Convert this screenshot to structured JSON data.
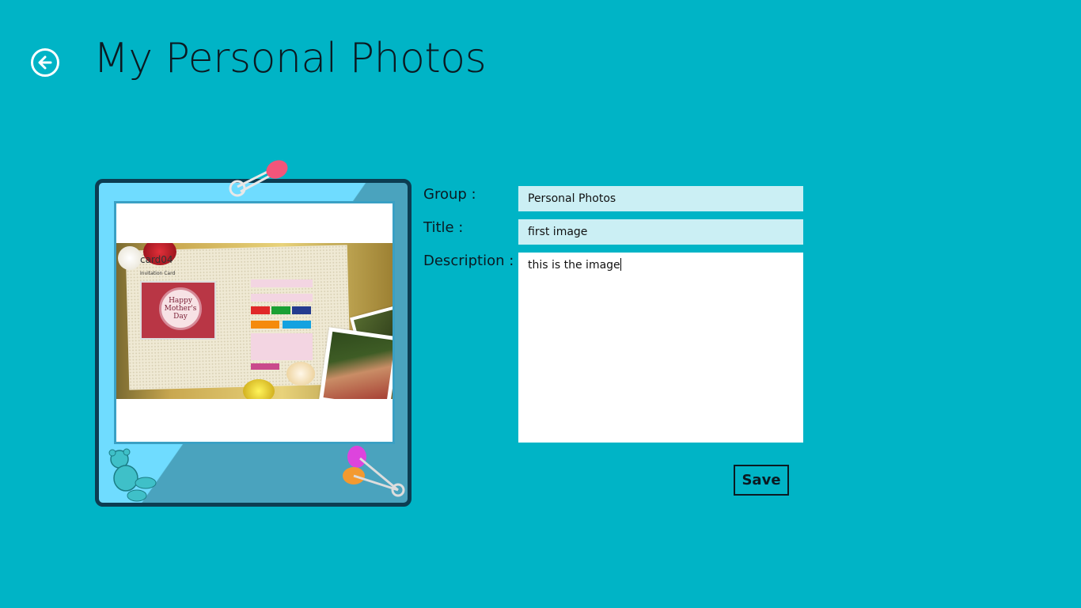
{
  "header": {
    "title": "My Personal Photos",
    "back_icon": "back-arrow-icon"
  },
  "photo": {
    "card_heading": "card04",
    "card_subheading": "Invitation Card",
    "badge_text": "Happy Mother's Day"
  },
  "form": {
    "group_label": "Group :",
    "group_value": "Personal Photos",
    "title_label": "Title :",
    "title_value": "first image",
    "description_label": "Description :",
    "description_value": "this is the image",
    "save_label": "Save"
  },
  "colors": {
    "background": "#00b4c6",
    "field_background": "#cbeff4",
    "text": "#0b1a22"
  }
}
